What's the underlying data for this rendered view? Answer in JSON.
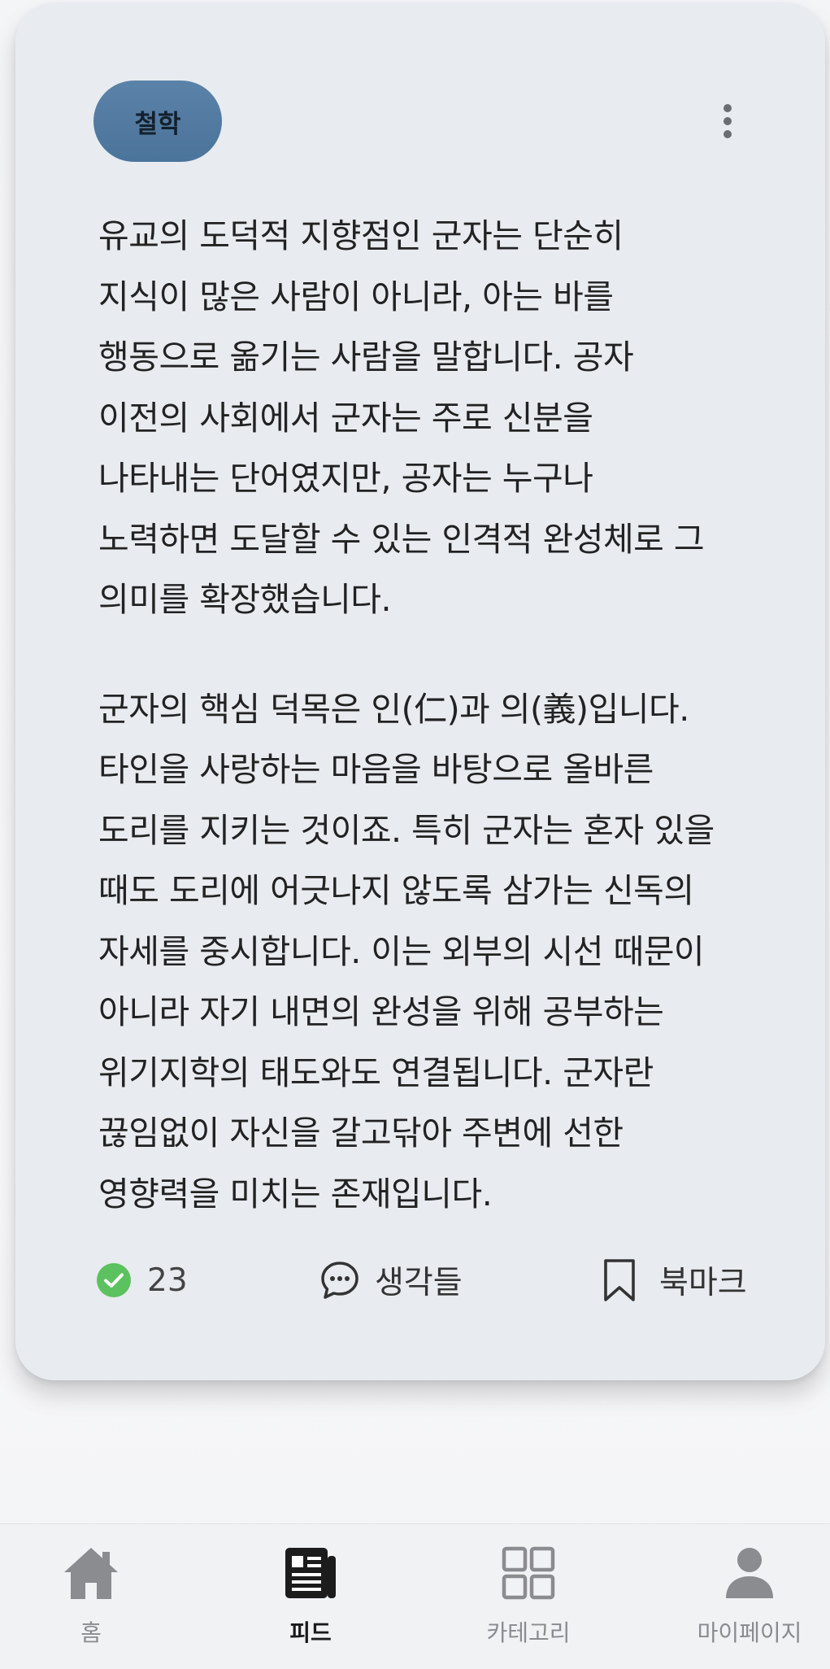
{
  "card": {
    "tag": "철학",
    "paragraphs": [
      "유교의 도덕적 지향점인 군자는 단순히\n지식이 많은 사람이 아니라, 아는 바를\n행동으로 옮기는 사람을 말합니다. 공자\n이전의 사회에서 군자는 주로 신분을\n나타내는 단어였지만, 공자는 누구나\n노력하면 도달할 수 있는 인격적 완성체로 그\n의미를 확장했습니다.",
      "군자의 핵심 덕목은 인(仁)과 의(義)입니다.\n타인을 사랑하는 마음을 바탕으로 올바른\n도리를 지키는 것이죠. 특히 군자는 혼자 있을\n때도 도리에 어긋나지 않도록 삼가는 신독의\n자세를 중시합니다. 이는 외부의 시선 때문이\n아니라 자기 내면의 완성을 위해 공부하는\n위기지학의 태도와도 연결됩니다. 군자란\n끊임없이 자신을 갈고닦아 주변에 선한\n영향력을 미치는 존재입니다."
    ],
    "actions": {
      "check_count": "23",
      "thoughts_label": "생각들",
      "bookmark_label": "북마크"
    }
  },
  "bottom_nav": [
    {
      "label": "홈",
      "icon": "home-icon"
    },
    {
      "label": "피드",
      "icon": "feed-icon",
      "active": true
    },
    {
      "label": "카테고리",
      "icon": "grid-icon"
    },
    {
      "label": "마이페이지",
      "icon": "person-icon"
    }
  ],
  "colors": {
    "tag_bg": "#567ea5",
    "check_green": "#5cc15f",
    "card_bg": "#e8ebef"
  }
}
